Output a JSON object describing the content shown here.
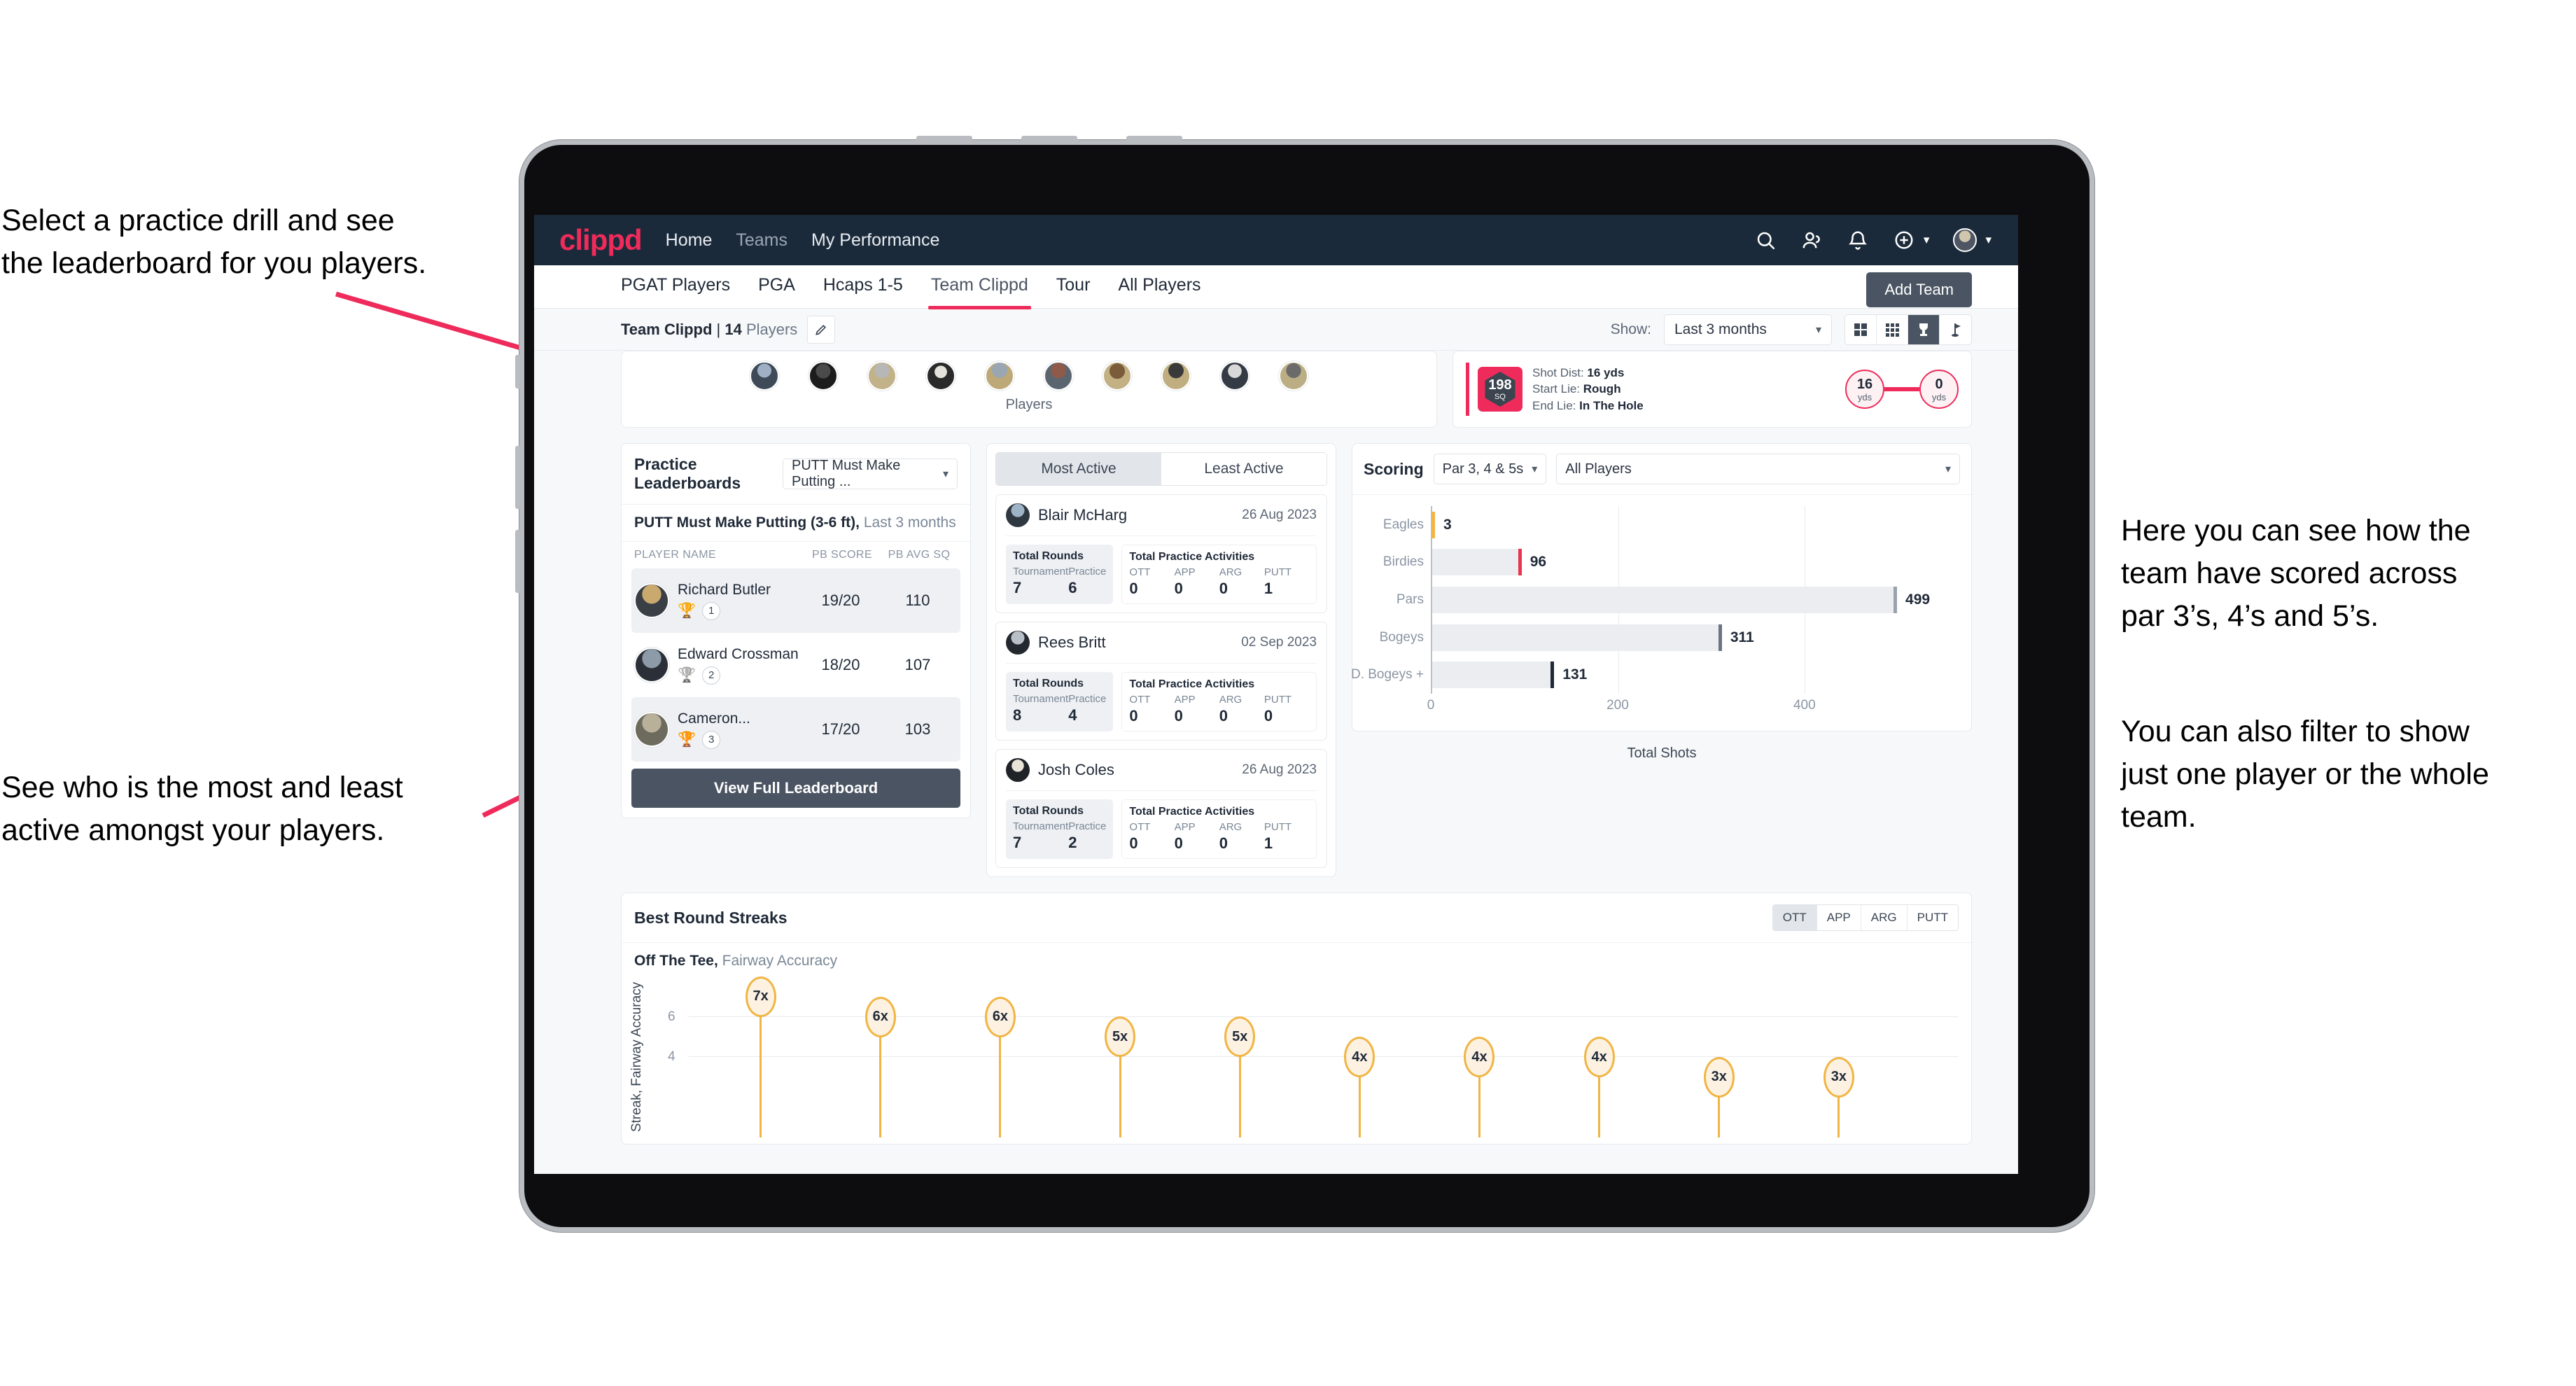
{
  "annotations": {
    "top_left": "Select a practice drill and see\nthe leaderboard for you players.",
    "bottom_left": "See who is the most and least\nactive amongst your players.",
    "right_1": "Here you can see how the\nteam have scored across\npar 3’s, 4’s and 5’s.",
    "right_2": "You can also filter to show\njust one player or the whole\nteam."
  },
  "colors": {
    "brand": "#ee2b5b",
    "navbar": "#1b2a3a",
    "dark_button": "#4a5462",
    "accent_gold": "#f0b545"
  },
  "topnav": {
    "logo": "clippd",
    "links": [
      {
        "label": "Home",
        "active": true
      },
      {
        "label": "Teams",
        "active": false
      },
      {
        "label": "My Performance",
        "active": true
      }
    ],
    "icons": [
      "search-icon",
      "people-icon",
      "bell-icon",
      "plus-circle-icon",
      "avatar"
    ]
  },
  "tabs": [
    {
      "label": "PGAT Players",
      "active": false
    },
    {
      "label": "PGA",
      "active": false
    },
    {
      "label": "Hcaps 1-5",
      "active": false
    },
    {
      "label": "Team Clippd",
      "active": true
    },
    {
      "label": "Tour",
      "active": false
    },
    {
      "label": "All Players",
      "active": false
    }
  ],
  "add_team_button": "Add Team",
  "subbar": {
    "team_name": "Team Clippd",
    "separator": " | ",
    "player_count": "14",
    "players_word": " Players",
    "show_label": "Show:",
    "range_value": "Last 3 months",
    "view_buttons": [
      "grid-large-icon",
      "grid-small-icon",
      "trophy-icon",
      "flag-icon"
    ],
    "active_view": "trophy-icon"
  },
  "players_strip": {
    "caption": "Players",
    "count": 10
  },
  "shot_card": {
    "sq_value": "198",
    "sq_unit": "SQ",
    "lines": [
      {
        "label": "Shot Dist: ",
        "value": "16 yds"
      },
      {
        "label": "Start Lie: ",
        "value": "Rough"
      },
      {
        "label": "End Lie: ",
        "value": "In The Hole"
      }
    ],
    "start_node": {
      "value": "16",
      "unit": "yds"
    },
    "end_node": {
      "value": "0",
      "unit": "yds"
    }
  },
  "leaderboard": {
    "title": "Practice Leaderboards",
    "drill_select": "PUTT Must Make Putting ...",
    "subtitle_bold": "PUTT Must Make Putting (3-6 ft),",
    "subtitle_rest": " Last 3 months",
    "columns": [
      "PLAYER NAME",
      "PB SCORE",
      "PB AVG SQ"
    ],
    "rows": [
      {
        "name": "Richard Butler",
        "rank": "1",
        "trophy": "gold",
        "pb_score": "19/20",
        "pb_avg_sq": "110"
      },
      {
        "name": "Edward Crossman",
        "rank": "2",
        "trophy": "silver",
        "pb_score": "18/20",
        "pb_avg_sq": "107"
      },
      {
        "name": "Cameron...",
        "rank": "3",
        "trophy": "bronze",
        "pb_score": "17/20",
        "pb_avg_sq": "103"
      }
    ],
    "button": "View Full Leaderboard"
  },
  "activity": {
    "tabs": [
      {
        "label": "Most Active",
        "active": true
      },
      {
        "label": "Least Active",
        "active": false
      }
    ],
    "rounds_title": "Total Rounds",
    "practice_title": "Total Practice Activities",
    "rounds_keys": [
      "Tournament",
      "Practice"
    ],
    "practice_keys": [
      "OTT",
      "APP",
      "ARG",
      "PUTT"
    ],
    "players": [
      {
        "name": "Blair McHarg",
        "date": "26 Aug 2023",
        "rounds": [
          "7",
          "6"
        ],
        "practice": [
          "0",
          "0",
          "0",
          "1"
        ]
      },
      {
        "name": "Rees Britt",
        "date": "02 Sep 2023",
        "rounds": [
          "8",
          "4"
        ],
        "practice": [
          "0",
          "0",
          "0",
          "0"
        ]
      },
      {
        "name": "Josh Coles",
        "date": "26 Aug 2023",
        "rounds": [
          "7",
          "2"
        ],
        "practice": [
          "0",
          "0",
          "0",
          "1"
        ]
      }
    ]
  },
  "scoring": {
    "title": "Scoring",
    "par_select": "Par 3, 4 & 5s",
    "player_select": "All Players"
  },
  "streaks": {
    "title": "Best Round Streaks",
    "segments": [
      {
        "label": "OTT",
        "active": true
      },
      {
        "label": "APP",
        "active": false
      },
      {
        "label": "ARG",
        "active": false
      },
      {
        "label": "PUTT",
        "active": false
      }
    ],
    "sub_bold": "Off The Tee,",
    "sub_rest": " Fairway Accuracy"
  },
  "chart_data": [
    {
      "type": "bar",
      "orientation": "horizontal",
      "title": "Scoring",
      "categories": [
        "Eagles",
        "Birdies",
        "Pars",
        "Bogeys",
        "D. Bogeys +"
      ],
      "values": [
        3,
        96,
        499,
        311,
        131
      ],
      "cap_colors": [
        "#f0b545",
        "#e8344e",
        "#9aa3ad",
        "#6b7481",
        "#1f2937"
      ],
      "xlabel": "Total Shots",
      "ylabel": "",
      "xlim": [
        0,
        520
      ],
      "xticks": [
        0,
        200,
        400
      ],
      "grid": true
    },
    {
      "type": "bar",
      "orientation": "vertical",
      "title": "Best Round Streaks",
      "subtitle": "Off The Tee, Fairway Accuracy",
      "ylabel": "Streak, Fairway Accuracy",
      "values": [
        7,
        6,
        6,
        5,
        5,
        4,
        4,
        4,
        3,
        3
      ],
      "labels": [
        "7x",
        "6x",
        "6x",
        "5x",
        "5x",
        "4x",
        "4x",
        "4x",
        "3x",
        "3x"
      ],
      "yticks": [
        4,
        6
      ],
      "ylim": [
        0,
        8
      ],
      "grid": true,
      "marker": "lollipop"
    }
  ]
}
